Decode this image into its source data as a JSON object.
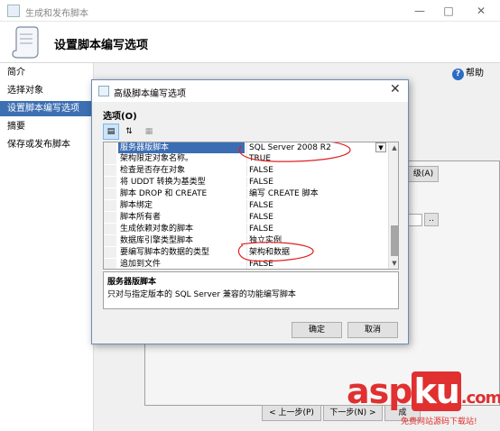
{
  "window": {
    "title": "生成和发布脚本",
    "header_title": "设置脚本编写选项",
    "help_label": "帮助"
  },
  "nav": {
    "items": [
      {
        "label": "简介",
        "active": false
      },
      {
        "label": "选择对象",
        "active": false
      },
      {
        "label": "设置脚本编写选项",
        "active": true
      },
      {
        "label": "摘要",
        "active": false
      },
      {
        "label": "保存或发布脚本",
        "active": false
      }
    ]
  },
  "main": {
    "advanced_btn_fragment": "级(A)",
    "browse_btn": "..",
    "prev_button": "< 上一步(P)",
    "next_button": "下一步(N) >",
    "finish_fragment": "成"
  },
  "dialog": {
    "title": "高级脚本编写选项",
    "options_label": "选项(O)",
    "rows": [
      {
        "key": "服务器版脚本",
        "value": "SQL Server 2008 R2",
        "selected": true
      },
      {
        "key": "架构限定对象名称。",
        "value": "TRUE",
        "selected": false
      },
      {
        "key": "检查是否存在对象",
        "value": "FALSE",
        "selected": false
      },
      {
        "key": "将 UDDT 转换为基类型",
        "value": "FALSE",
        "selected": false
      },
      {
        "key": "脚本 DROP 和 CREATE",
        "value": "编写 CREATE 脚本",
        "selected": false
      },
      {
        "key": "脚本绑定",
        "value": "FALSE",
        "selected": false
      },
      {
        "key": "脚本所有者",
        "value": "FALSE",
        "selected": false
      },
      {
        "key": "生成依赖对象的脚本",
        "value": "FALSE",
        "selected": false
      },
      {
        "key": "数据库引擎类型脚本",
        "value": "独立实例",
        "selected": false
      },
      {
        "key": "要编写脚本的数据的类型",
        "value": "架构和数据",
        "selected": false
      },
      {
        "key": "追加到文件",
        "value": "FALSE",
        "selected": false
      }
    ],
    "description_title": "服务器版脚本",
    "description_text": "只对与指定版本的 SQL Server 兼容的功能编写脚本",
    "ok_button": "确定",
    "cancel_button": "取消"
  },
  "watermark": {
    "brand_a": "asp",
    "brand_b": "ku",
    "brand_c": ".com",
    "sub": "免费网站源码下载站!"
  },
  "colors": {
    "selection": "#3b6db5",
    "annotation": "#e02020",
    "watermark": "#e03030"
  }
}
